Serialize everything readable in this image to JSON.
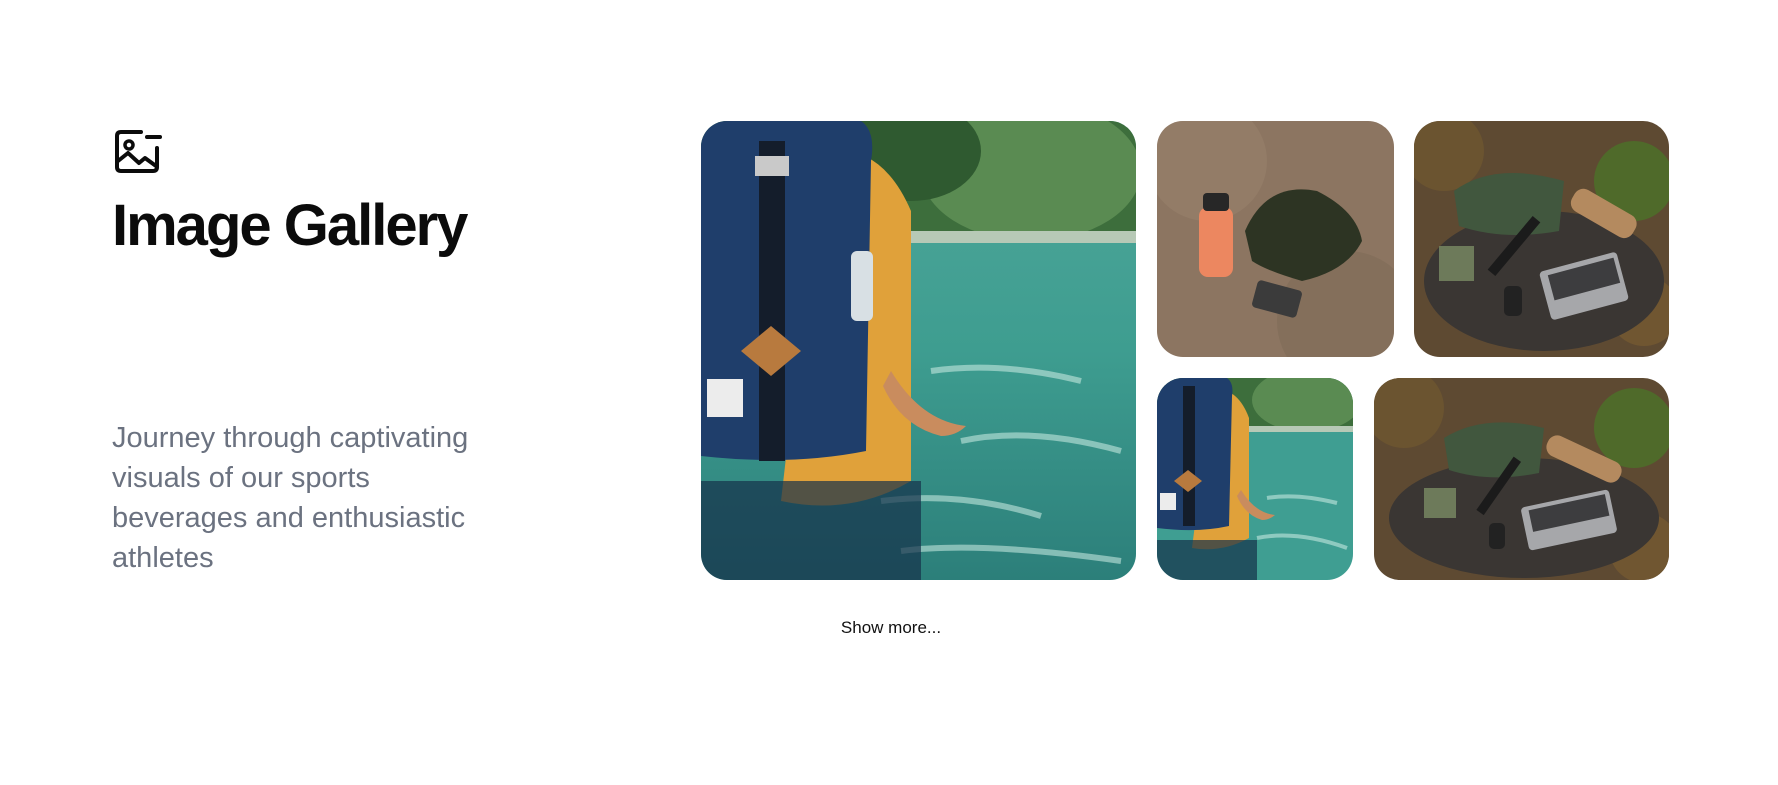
{
  "header": {
    "icon": "image-gallery-icon",
    "title": "Image Gallery"
  },
  "description": "Journey through captivating visuals of our sports beverages and enthusiastic athletes",
  "gallery": {
    "images": [
      {
        "subject": "hiker-with-backpack-in-water"
      },
      {
        "subject": "water-bottle-and-bag-on-sand"
      },
      {
        "subject": "gear-and-laptop-on-tree-stump"
      },
      {
        "subject": "hiker-with-backpack-in-water"
      },
      {
        "subject": "gear-and-laptop-on-tree-stump"
      }
    ]
  },
  "actions": {
    "show_more_label": "Show more..."
  },
  "colors": {
    "title": "#0b0b0b",
    "description": "#6b7280",
    "background": "#ffffff"
  }
}
